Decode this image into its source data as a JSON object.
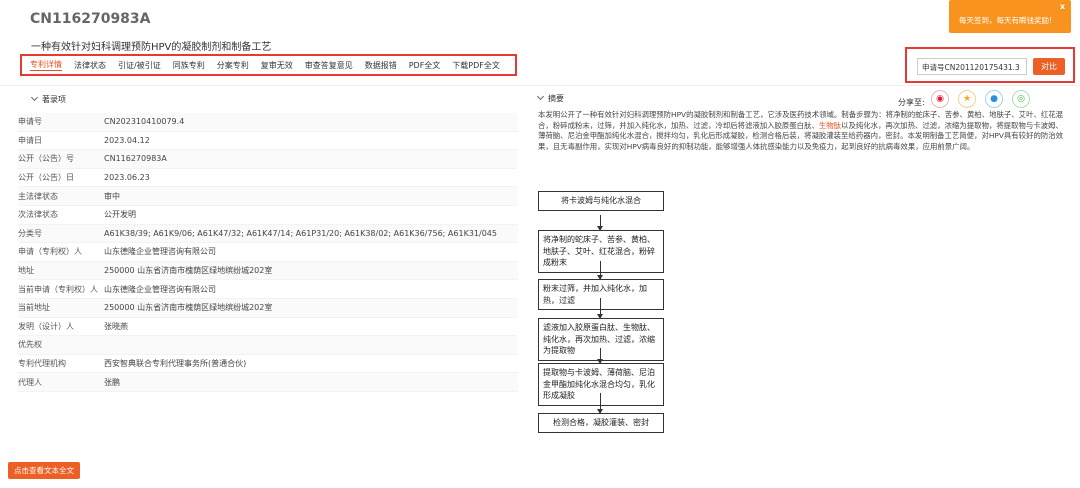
{
  "header": {
    "publication_number": "CN116270983A",
    "title": "一种有效针对妇科调理预防HPV的凝胶制剂和制备工艺"
  },
  "tabs": [
    {
      "label": "专利详情"
    },
    {
      "label": "法律状态"
    },
    {
      "label": "引证/被引证"
    },
    {
      "label": "同族专利"
    },
    {
      "label": "分案专利"
    },
    {
      "label": "复审无效"
    },
    {
      "label": "审查答复意见"
    },
    {
      "label": "数据报错"
    },
    {
      "label": "PDF全文"
    },
    {
      "label": "下载PDF全文"
    }
  ],
  "compare": {
    "input_value": "申请号CN201120175431.3",
    "button_label": "对比"
  },
  "toast": {
    "text": "每天签到，每天有瞬钱奖励!",
    "close": "x"
  },
  "bibliography": {
    "section_title": "著录项",
    "rows": [
      {
        "label": "申请号",
        "value": "CN202310410079.4"
      },
      {
        "label": "申请日",
        "value": "2023.04.12"
      },
      {
        "label": "公开（公告）号",
        "value": "CN116270983A"
      },
      {
        "label": "公开（公告）日",
        "value": "2023.06.23"
      },
      {
        "label": "主法律状态",
        "value": "审中"
      },
      {
        "label": "次法律状态",
        "value": "公开发明"
      },
      {
        "label": "分类号",
        "value": "A61K38/39; A61K9/06; A61K47/32; A61K47/14; A61P31/20; A61K38/02; A61K36/756; A61K31/045"
      },
      {
        "label": "申请（专利权）人",
        "value": "山东德隆企业管理咨询有限公司"
      },
      {
        "label": "地址",
        "value": "250000 山东省济南市槐荫区绿地缤纷城202室"
      },
      {
        "label": "当前申请（专利权）人",
        "value": "山东德隆企业管理咨询有限公司"
      },
      {
        "label": "当前地址",
        "value": "250000 山东省济南市槐荫区绿地缤纷城202室"
      },
      {
        "label": "发明（设计）人",
        "value": "张晓燕"
      },
      {
        "label": "优先权",
        "value": ""
      },
      {
        "label": "专利代理机构",
        "value": "西安智典联合专利代理事务所(普通合伙)"
      },
      {
        "label": "代理人",
        "value": "张鹏"
      }
    ]
  },
  "abstract": {
    "section_title": "摘要",
    "share_label": "分享至:",
    "share_icons": [
      "weibo-icon",
      "qzone-icon",
      "qq-icon",
      "wechat-icon"
    ],
    "text_before": "本发明公开了一种有效针对妇科调理预防HPV的凝胶制剂和制备工艺，它涉及医药技术领域。制备步骤为：将净制的蛇床子、苦参、黄柏、地肤子、艾叶、红花混合，粉碎成粉末，过筛，并加入纯化水，加热、过滤，冷却后将滤液加入胶原蛋白肽、",
    "highlight": "生物肽",
    "text_after": "以及纯化水，再次加热、过滤，浓缩为提取物，将提取物与卡波姆、薄荷脑、尼泊金甲酯加纯化水混合，搅拌均匀，乳化后形成凝胶，检测合格后装，将凝胶灌装至给药器内，密封。本发明制备工艺简便，对HPV具有较好的防治效果，且无毒副作用，实现对HPV病毒良好的抑制功能，能够增强人体抗感染能力以及免疫力，起到良好的抗病毒效果，应用前景广阔。"
  },
  "flowchart": {
    "steps": [
      "将卡波姆与纯化水混合",
      "将净制的蛇床子、苦参、黄柏、地肤子、艾叶、红花混合，粉碎成粉末",
      "粉末过筛，并加入纯化水，加热，过滤",
      "滤液加入胶原蛋白肽、生物肽、纯化水，再次加热、过滤，浓缩为提取物",
      "提取物与卡波姆、薄荷脑、尼泊金甲酯加纯化水混合均匀，乳化形成凝胶",
      "检测合格，凝胶灌装、密封"
    ]
  },
  "footer": {
    "view_full_text_button": "点击查看文本全文"
  },
  "colors": {
    "accent": "#ec6026",
    "highlight_box": "#e53935",
    "toast": "#f7931e"
  }
}
